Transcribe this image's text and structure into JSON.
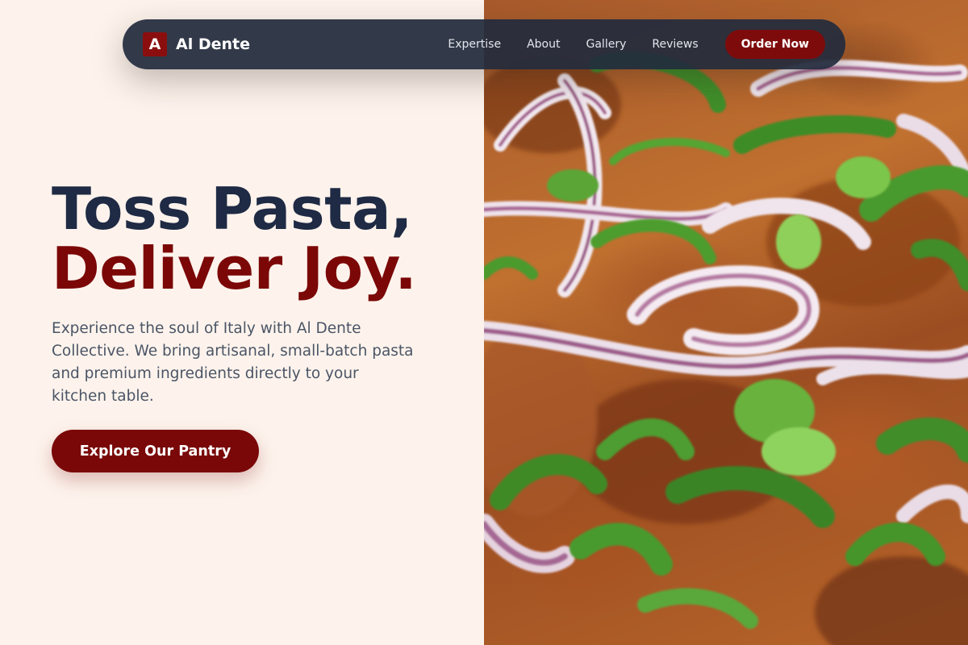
{
  "brand": {
    "mark": "A",
    "name": "Al Dente",
    "accent_color": "#7b0707"
  },
  "nav": {
    "links": [
      "Expertise",
      "About",
      "Gallery",
      "Reviews"
    ],
    "cta_label": "Order Now"
  },
  "hero": {
    "title_line_1": "Toss Pasta,",
    "title_line_2": "Deliver Joy.",
    "description": "Experience the soul of Italy with Al Dente Collective. We bring artisanal, small-batch pasta and premium ingredients directly to your kitchen table.",
    "cta_label": "Explore Our Pantry",
    "image_subject": "close-up of pasta topped with red onion rings and sliced green onion"
  },
  "colors": {
    "page_background": "#fdf3ec",
    "navbar_background": "#222b3c",
    "heading_dark": "#1f2a44",
    "button_red": "#7a0808"
  }
}
